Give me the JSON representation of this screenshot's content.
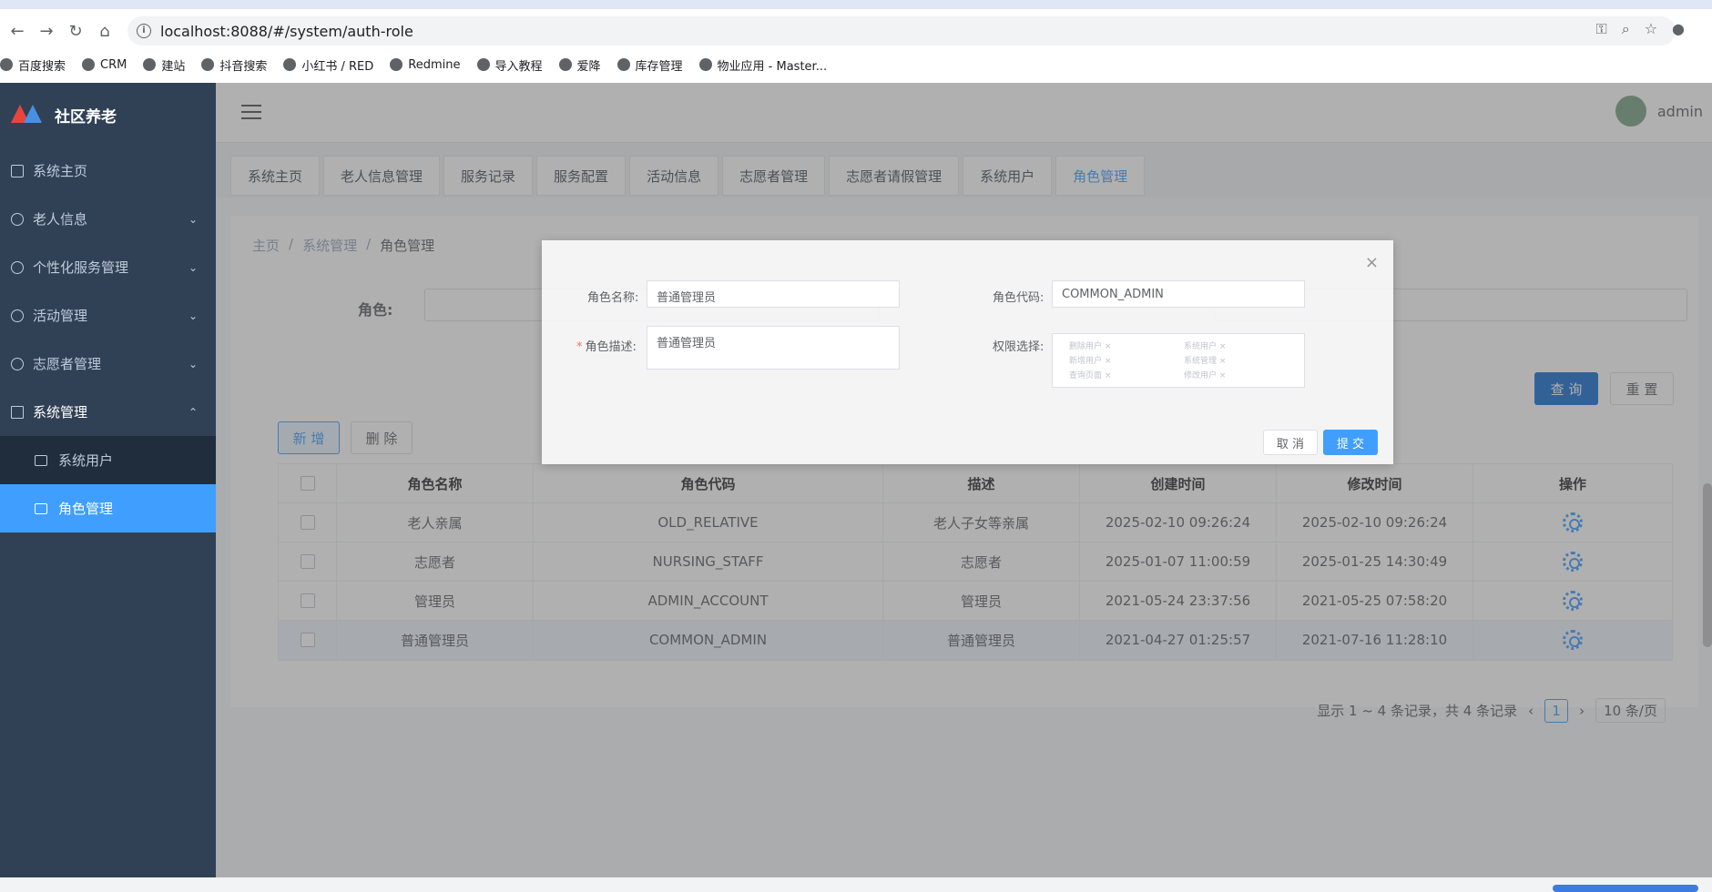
{
  "browser": {
    "url": "localhost:8088/#/system/auth-role",
    "bookmarks": [
      "百度搜索",
      "CRM",
      "建站",
      "抖音搜索",
      "小红书 / RED",
      "Redmine",
      "导入教程",
      "爱降",
      "库存管理",
      "物业应用 - Master..."
    ]
  },
  "app": {
    "title": "社区养老",
    "user": "admin"
  },
  "sidebar": {
    "items": [
      {
        "label": "系统主页"
      },
      {
        "label": "老人信息"
      },
      {
        "label": "个性化服务管理"
      },
      {
        "label": "活动管理"
      },
      {
        "label": "志愿者管理"
      },
      {
        "label": "系统管理"
      }
    ],
    "sub": [
      {
        "label": "系统用户"
      },
      {
        "label": "角色管理"
      }
    ]
  },
  "tags": [
    "系统主页",
    "老人信息管理",
    "服务记录",
    "服务配置",
    "活动信息",
    "志愿者管理",
    "志愿者请假管理",
    "系统用户",
    "角色管理"
  ],
  "breadcrumb": [
    "主页",
    "/",
    "系统管理",
    "/",
    "角色管理"
  ],
  "filter": {
    "role_label": "角色:",
    "query": "查 询",
    "reset": "重 置"
  },
  "actions": {
    "add": "新 增",
    "delete": "删 除"
  },
  "table": {
    "headers": [
      "角色名称",
      "角色代码",
      "描述",
      "创建时间",
      "修改时间",
      "操作"
    ],
    "rows": [
      [
        "老人亲属",
        "OLD_RELATIVE",
        "老人子女等亲属",
        "2025-02-10 09:26:24",
        "2025-02-10 09:26:24"
      ],
      [
        "志愿者",
        "NURSING_STAFF",
        "志愿者",
        "2025-01-07 11:00:59",
        "2025-01-25 14:30:49"
      ],
      [
        "管理员",
        "ADMIN_ACCOUNT",
        "管理员",
        "2021-05-24 23:37:56",
        "2021-05-25 07:58:20"
      ],
      [
        "普通管理员",
        "COMMON_ADMIN",
        "普通管理员",
        "2021-04-27 01:25:57",
        "2021-07-16 11:28:10"
      ]
    ]
  },
  "pagination": {
    "summary": "显示 1 ~ 4 条记录，共 4 条记录",
    "page": "1",
    "size": "10 条/页"
  },
  "modal": {
    "name_label": "角色名称:",
    "name_value": "普通管理员",
    "code_label": "角色代码:",
    "code_value": "COMMON_ADMIN",
    "desc_label": "角色描述:",
    "desc_value": "普通管理员",
    "perm_label": "权限选择:",
    "perms": [
      "删除用户 ×",
      "系统用户 ×",
      "新增用户 ×",
      "系统管理 ×",
      "查询页面 ×",
      "修改用户 ×"
    ],
    "cancel": "取 消",
    "submit": "提 交"
  }
}
